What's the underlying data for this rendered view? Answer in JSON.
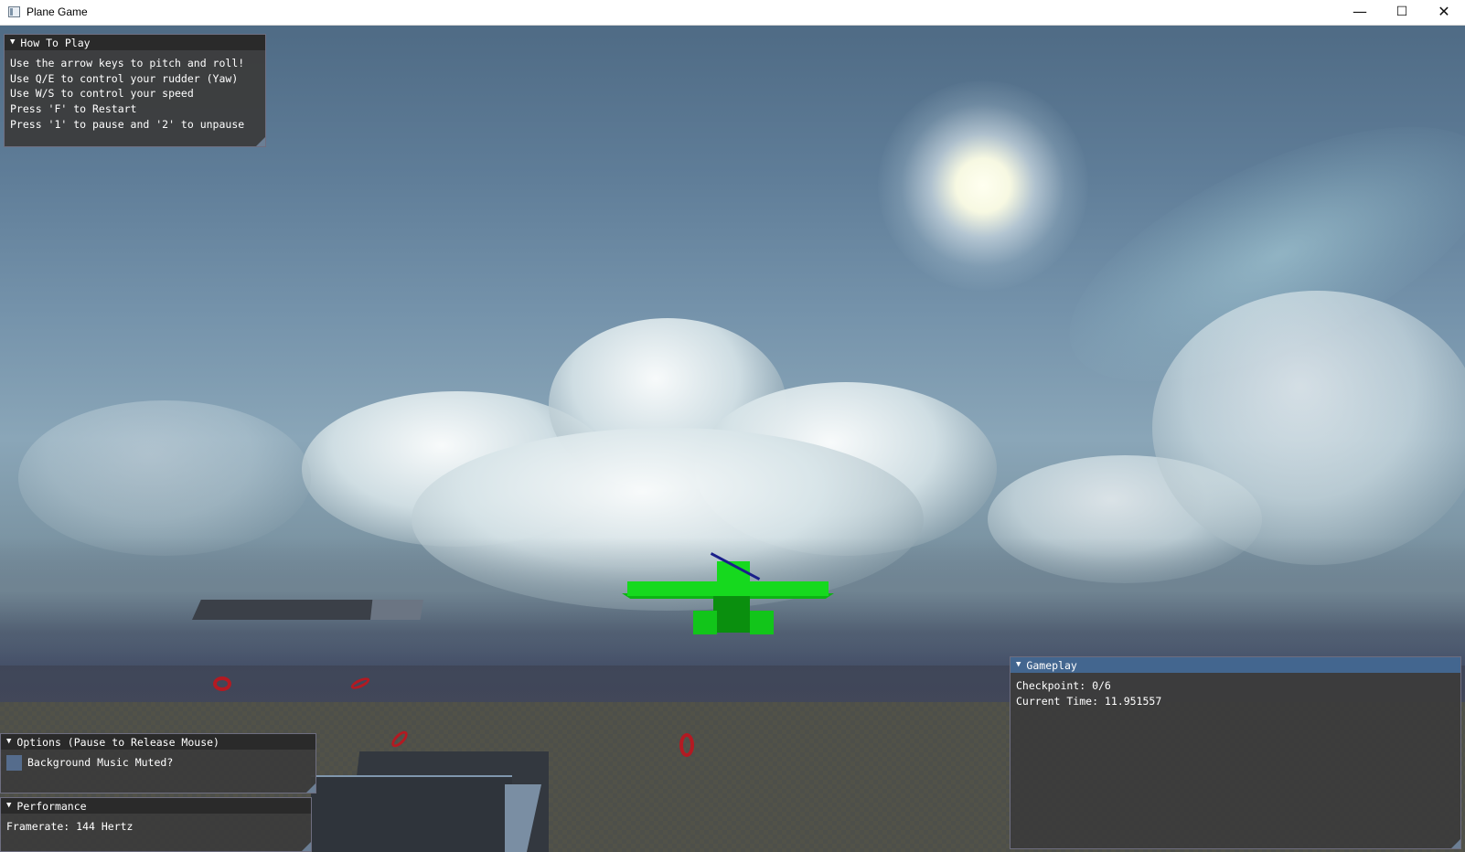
{
  "window": {
    "title": "Plane Game",
    "controls": {
      "minimize": "—",
      "maximize": "☐",
      "close": "✕"
    }
  },
  "how_to_play": {
    "title": "How To Play",
    "lines": [
      "Use the arrow keys to pitch and roll!",
      "Use Q/E to control your rudder (Yaw)",
      "Use W/S to control your speed",
      "Press 'F' to Restart",
      "Press '1' to pause and '2' to unpause"
    ]
  },
  "options": {
    "title": "Options (Pause to Release Mouse)",
    "music_muted_label": "Background Music Muted?",
    "music_muted": false
  },
  "performance": {
    "title": "Performance",
    "framerate": "Framerate: 144 Hertz"
  },
  "gameplay": {
    "title": "Gameplay",
    "checkpoint": "Checkpoint: 0/6",
    "current_time": "Current Time: 11.951557"
  },
  "colors": {
    "plane": "#16d91e",
    "ring": "#b31a22",
    "panel_bg": "#3c3c3c",
    "panel_header_active": "#43668f"
  }
}
